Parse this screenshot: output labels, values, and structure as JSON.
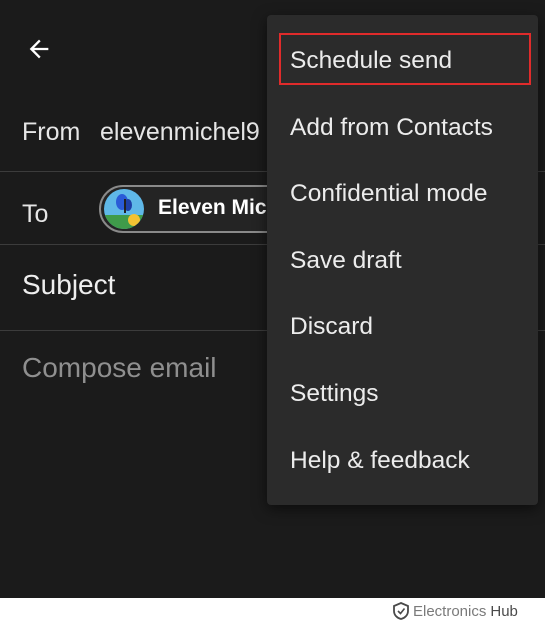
{
  "compose": {
    "from_label": "From",
    "from_value": "elevenmichel9",
    "to_label": "To",
    "to_chip_name": "Eleven Mic",
    "subject_placeholder": "Subject",
    "body_placeholder": "Compose email"
  },
  "overflow_menu": {
    "highlighted_item": "Schedule send",
    "items": [
      {
        "label": "Schedule send"
      },
      {
        "label": "Add from Contacts"
      },
      {
        "label": "Confidential mode"
      },
      {
        "label": "Save draft"
      },
      {
        "label": "Discard"
      },
      {
        "label": "Settings"
      },
      {
        "label": "Help & feedback"
      }
    ]
  },
  "watermark": {
    "brand_part1": "Electronics",
    "brand_part2": "Hub"
  },
  "colors": {
    "background": "#1b1b1b",
    "menu_background": "#2b2b2b",
    "highlight": "#e02b2b",
    "text": "#e6e6e6",
    "placeholder_text": "#8f8f8f"
  },
  "icons": {
    "back": "arrow-left-icon",
    "avatar": "butterfly-avatar-icon",
    "watermark": "shield-logo-icon"
  }
}
